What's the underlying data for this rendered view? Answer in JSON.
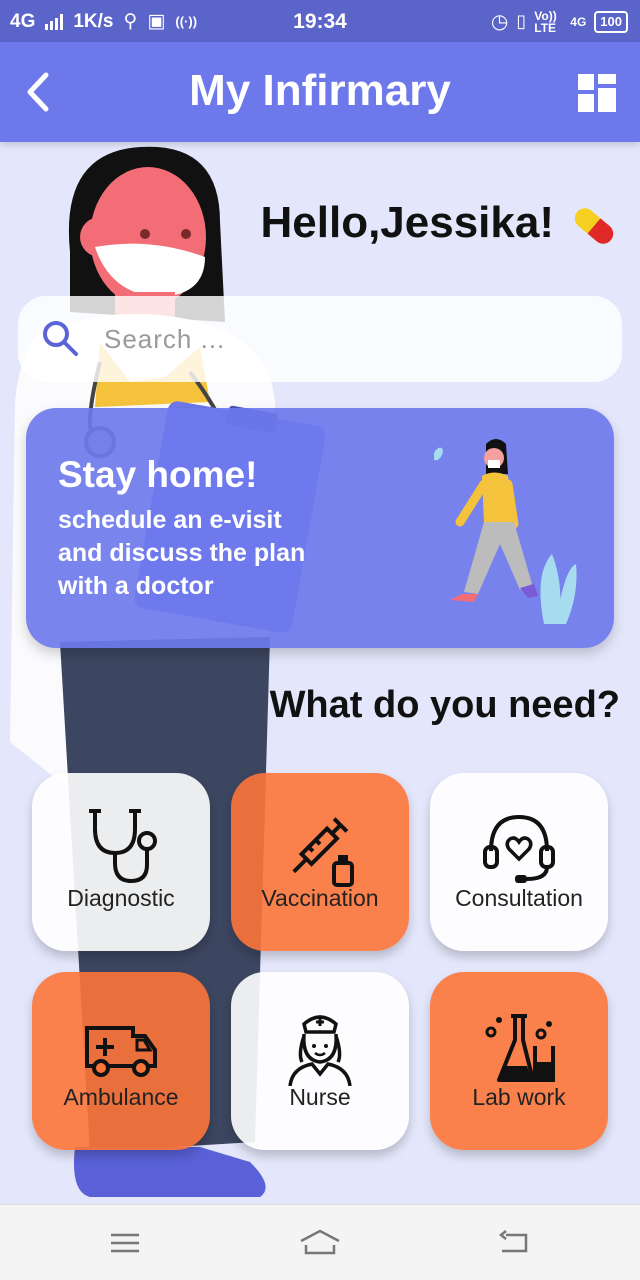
{
  "status_bar": {
    "network": "4G",
    "speed": "1K/s",
    "time": "19:34",
    "volte": "Vo)) LTE",
    "network_right": "4G",
    "battery": "100"
  },
  "app_bar": {
    "title": "My Infirmary",
    "back_icon": "chevron-left-icon",
    "menu_icon": "dashboard-grid-icon"
  },
  "greeting": "Hello,Jessika!",
  "search": {
    "placeholder": "Search ...",
    "value": ""
  },
  "banner": {
    "title": "Stay home!",
    "lines": [
      "schedule an e-visit",
      "and discuss the plan",
      "with a doctor"
    ]
  },
  "section_title": "What do you need?",
  "services": [
    {
      "label": "Diagnostic",
      "icon": "stethoscope-icon"
    },
    {
      "label": "Vaccination",
      "icon": "syringe-icon"
    },
    {
      "label": "Consultation",
      "icon": "headset-heart-icon"
    },
    {
      "label": "Ambulance",
      "icon": "ambulance-icon"
    },
    {
      "label": "Nurse",
      "icon": "nurse-icon"
    },
    {
      "label": "Lab work",
      "icon": "lab-flasks-icon"
    }
  ],
  "colors": {
    "primary": "#6d78ea",
    "status_bar": "#5b64c9",
    "background": "#e4e7fb",
    "accent_orange": "#fc7438",
    "tile_white": "#ffffff"
  }
}
